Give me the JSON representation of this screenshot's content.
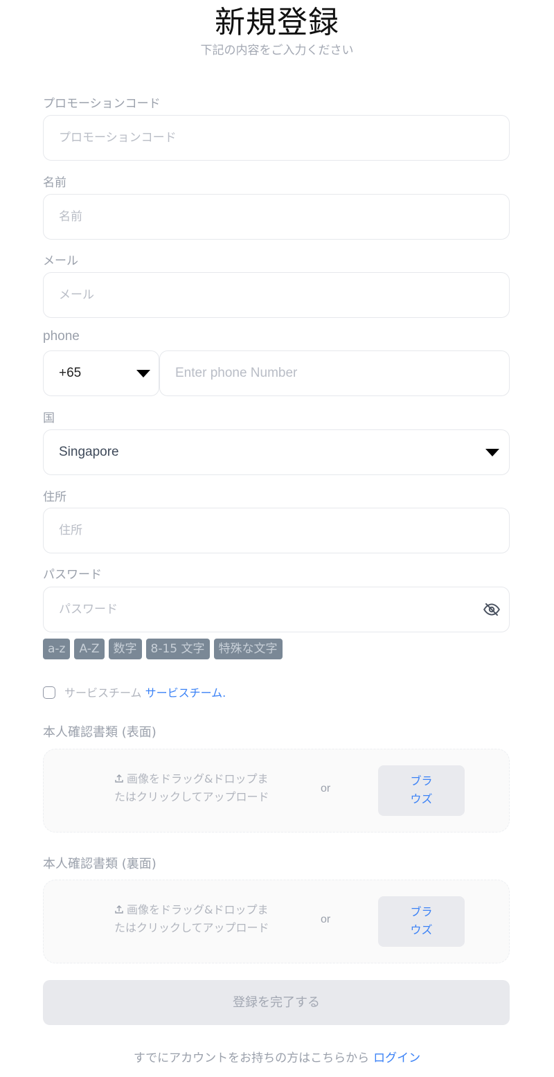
{
  "header": {
    "title": "新規登録",
    "subtitle": "下記の内容をご入力ください"
  },
  "fields": {
    "promo": {
      "label": "プロモーションコード",
      "placeholder": "プロモーションコード"
    },
    "name": {
      "label": "名前",
      "placeholder": "名前"
    },
    "email": {
      "label": "メール",
      "placeholder": "メール"
    },
    "phone": {
      "label": "phone",
      "code": "+65",
      "placeholder": "Enter phone Number"
    },
    "country": {
      "label": "国",
      "value": "Singapore"
    },
    "address": {
      "label": "住所",
      "placeholder": "住所"
    },
    "password": {
      "label": "パスワード",
      "placeholder": "パスワード"
    }
  },
  "password_rules": [
    "a-z",
    "A-Z",
    "数字",
    "8-15 文字",
    "特殊な文字"
  ],
  "terms": {
    "text": "サービスチーム",
    "link": "サービスチーム",
    "suffix": "."
  },
  "uploads": {
    "front": {
      "label": "本人確認書類 (表面)",
      "hint": "画像をドラッグ&ドロップまたはクリックしてアップロード",
      "or": "or",
      "browse": "ブラウズ"
    },
    "back": {
      "label": "本人確認書類 (裏面)",
      "hint": "画像をドラッグ&ドロップまたはクリックしてアップロード",
      "or": "or",
      "browse": "ブラウズ"
    }
  },
  "submit_label": "登録を完了する",
  "footer": {
    "text": "すでにアカウントをお持ちの方はこちらから",
    "login": "ログイン"
  },
  "colors": {
    "link": "#3b82f6",
    "chip_bg": "#7a8896",
    "button_bg": "#e8e9ed"
  },
  "icons": {
    "password_toggle": "eye-off-icon",
    "upload": "upload-icon",
    "dropdown": "caret-down-icon"
  }
}
